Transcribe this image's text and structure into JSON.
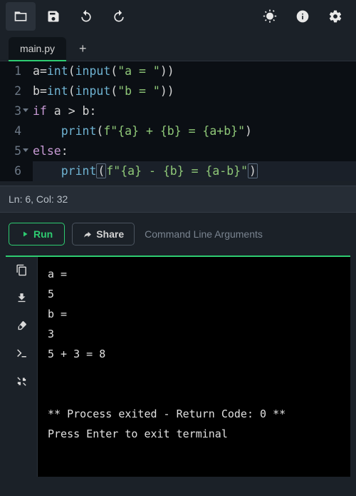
{
  "toolbar": {
    "icons": [
      "open-icon",
      "save-icon",
      "undo-icon",
      "redo-icon",
      "theme-icon",
      "info-icon",
      "settings-icon"
    ]
  },
  "tabs": {
    "active": "main.py",
    "add_label": "+"
  },
  "editor": {
    "lines": [
      {
        "n": 1,
        "fold": false,
        "tokens": [
          [
            "plain",
            "a"
          ],
          [
            "op",
            "="
          ],
          [
            "fn",
            "int"
          ],
          [
            "plain",
            "("
          ],
          [
            "fn",
            "input"
          ],
          [
            "plain",
            "("
          ],
          [
            "str",
            "\"a = \""
          ],
          [
            "plain",
            "))"
          ]
        ]
      },
      {
        "n": 2,
        "fold": false,
        "tokens": [
          [
            "plain",
            "b"
          ],
          [
            "op",
            "="
          ],
          [
            "fn",
            "int"
          ],
          [
            "plain",
            "("
          ],
          [
            "fn",
            "input"
          ],
          [
            "plain",
            "("
          ],
          [
            "str",
            "\"b = \""
          ],
          [
            "plain",
            "))"
          ]
        ]
      },
      {
        "n": 3,
        "fold": true,
        "tokens": [
          [
            "kw",
            "if"
          ],
          [
            "plain",
            " a "
          ],
          [
            "op",
            ">"
          ],
          [
            "plain",
            " b:"
          ]
        ]
      },
      {
        "n": 4,
        "fold": false,
        "tokens": [
          [
            "plain",
            "    "
          ],
          [
            "fn",
            "print"
          ],
          [
            "plain",
            "("
          ],
          [
            "str",
            "f\"{a} + {b} = {a+b}\""
          ],
          [
            "plain",
            ")"
          ]
        ]
      },
      {
        "n": 5,
        "fold": true,
        "tokens": [
          [
            "kw",
            "else"
          ],
          [
            "plain",
            ":"
          ]
        ]
      },
      {
        "n": 6,
        "fold": false,
        "cursor": true,
        "tokens": [
          [
            "plain",
            "    "
          ],
          [
            "fn",
            "print"
          ],
          [
            "plain_hl",
            "("
          ],
          [
            "str",
            "f\"{a} - {b} = {a-b}\""
          ],
          [
            "plain_hl",
            ")"
          ]
        ]
      }
    ]
  },
  "status": {
    "text": "Ln: 6, Col: 32"
  },
  "controls": {
    "run_label": "Run",
    "share_label": "Share",
    "cmdline_placeholder": "Command Line Arguments"
  },
  "terminal": {
    "lines": [
      "a = ",
      "5",
      "b = ",
      "3",
      "5 + 3 = 8",
      "",
      "",
      "** Process exited - Return Code: 0 **",
      "Press Enter to exit terminal"
    ]
  }
}
